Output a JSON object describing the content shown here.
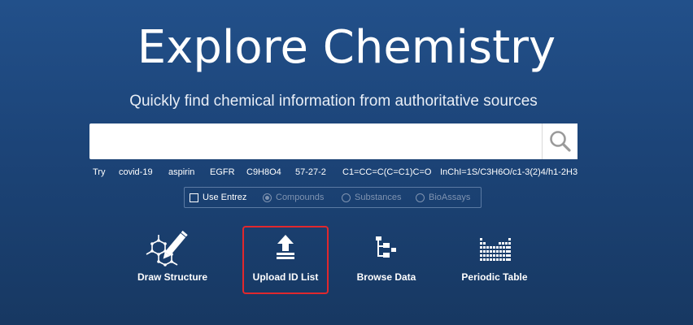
{
  "hero": {
    "title": "Explore Chemistry",
    "subtitle": "Quickly find chemical information from authoritative sources"
  },
  "search": {
    "value": "",
    "placeholder": "",
    "button_icon": "search-icon"
  },
  "try_row": {
    "label": "Try",
    "examples": [
      "covid-19",
      "aspirin",
      "EGFR",
      "C9H8O4",
      "57-27-2",
      "C1=CC=C(C=C1)C=O",
      "InChI=1S/C3H6O/c1-3(2)4/h1-2H3"
    ]
  },
  "search_options": {
    "use_entrez": {
      "label": "Use Entrez",
      "checked": false
    },
    "radios": [
      {
        "label": "Compounds",
        "checked": true,
        "disabled": true
      },
      {
        "label": "Substances",
        "checked": false,
        "disabled": true
      },
      {
        "label": "BioAssays",
        "checked": false,
        "disabled": true
      }
    ]
  },
  "tools": [
    {
      "label": "Draw Structure",
      "icon": "draw-structure-icon"
    },
    {
      "label": "Upload ID List",
      "icon": "upload-icon",
      "highlighted": true
    },
    {
      "label": "Browse Data",
      "icon": "browse-data-icon"
    },
    {
      "label": "Periodic Table",
      "icon": "periodic-table-icon"
    }
  ],
  "colors": {
    "background_top": "#22508a",
    "background_bottom": "#173862",
    "highlight": "#e0282d"
  }
}
